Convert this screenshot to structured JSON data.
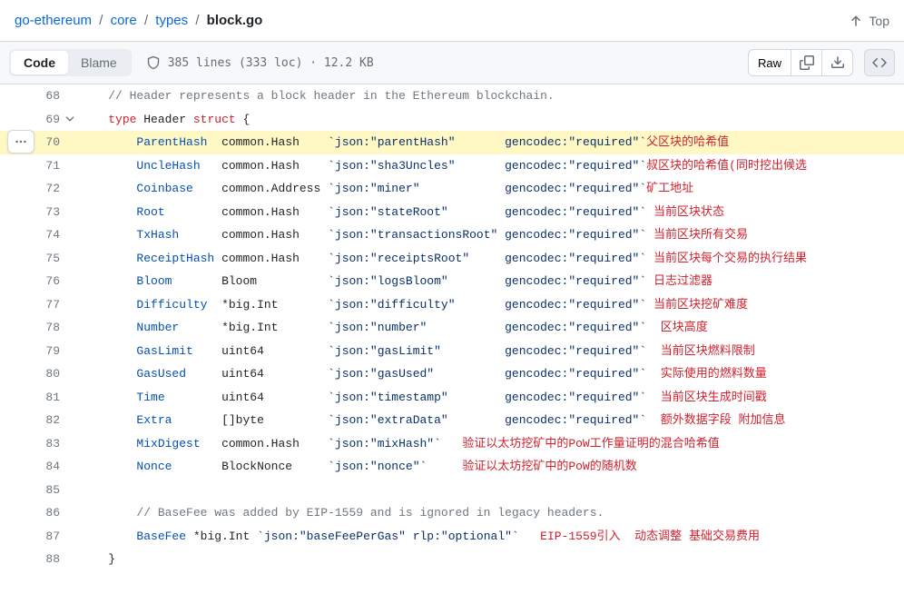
{
  "breadcrumb": {
    "parts": [
      "go-ethereum",
      "core",
      "types"
    ],
    "current": "block.go"
  },
  "top_link": "Top",
  "tabs": {
    "code": "Code",
    "blame": "Blame"
  },
  "file_info": "385 lines (333 loc) · 12.2 KB",
  "raw_label": "Raw",
  "code": {
    "lines": [
      {
        "n": 68,
        "comment": "// Header represents a block header in the Ethereum blockchain."
      },
      {
        "n": 69,
        "decl": {
          "k1": "type",
          "name": "Header",
          "k2": "struct",
          "brace": " {"
        },
        "chev": true
      },
      {
        "n": 70,
        "hl": true,
        "field": "ParentHash",
        "type": "common.Hash",
        "tag": "`json:\"parentHash\"       gencodec:\"required\"`",
        "anno": "父区块的哈希值"
      },
      {
        "n": 71,
        "field": "UncleHash",
        "type": "common.Hash",
        "tag": "`json:\"sha3Uncles\"       gencodec:\"required\"`",
        "anno": "叔区块的哈希值(同时挖出候选"
      },
      {
        "n": 72,
        "field": "Coinbase",
        "type": "common.Address",
        "tag": "`json:\"miner\"            gencodec:\"required\"`",
        "anno": "矿工地址"
      },
      {
        "n": 73,
        "field": "Root",
        "type": "common.Hash",
        "tag": "`json:\"stateRoot\"        gencodec:\"required\"`",
        "anno": " 当前区块状态"
      },
      {
        "n": 74,
        "field": "TxHash",
        "type": "common.Hash",
        "tag": "`json:\"transactionsRoot\" gencodec:\"required\"`",
        "anno": " 当前区块所有交易"
      },
      {
        "n": 75,
        "field": "ReceiptHash",
        "type": "common.Hash",
        "tag": "`json:\"receiptsRoot\"     gencodec:\"required\"`",
        "anno": " 当前区块每个交易的执行结果"
      },
      {
        "n": 76,
        "field": "Bloom",
        "type": "Bloom",
        "tag": "`json:\"logsBloom\"        gencodec:\"required\"`",
        "anno": " 日志过滤器"
      },
      {
        "n": 77,
        "field": "Difficulty",
        "type": "*big.Int",
        "tag": "`json:\"difficulty\"       gencodec:\"required\"`",
        "anno": " 当前区块挖矿难度"
      },
      {
        "n": 78,
        "field": "Number",
        "type": "*big.Int",
        "tag": "`json:\"number\"           gencodec:\"required\"`",
        "anno": "  区块高度"
      },
      {
        "n": 79,
        "field": "GasLimit",
        "type": "uint64",
        "tag": "`json:\"gasLimit\"         gencodec:\"required\"`",
        "anno": "  当前区块燃料限制"
      },
      {
        "n": 80,
        "field": "GasUsed",
        "type": "uint64",
        "tag": "`json:\"gasUsed\"          gencodec:\"required\"`",
        "anno": "  实际使用的燃料数量"
      },
      {
        "n": 81,
        "field": "Time",
        "type": "uint64",
        "tag": "`json:\"timestamp\"        gencodec:\"required\"`",
        "anno": "  当前区块生成时间戳"
      },
      {
        "n": 82,
        "field": "Extra",
        "type": "[]byte",
        "tag": "`json:\"extraData\"        gencodec:\"required\"`",
        "anno": "  额外数据字段 附加信息"
      },
      {
        "n": 83,
        "field": "MixDigest",
        "type": "common.Hash",
        "tag": "`json:\"mixHash\"`",
        "anno": "   验证以太坊挖矿中的PoW工作量证明的混合哈希值"
      },
      {
        "n": 84,
        "field": "Nonce",
        "type": "BlockNonce",
        "tag": "`json:\"nonce\"`",
        "anno": "     验证以太坊挖矿中的PoW的随机数"
      },
      {
        "n": 85,
        "blank": true
      },
      {
        "n": 86,
        "comment2": "// BaseFee was added by EIP-1559 and is ignored in legacy headers."
      },
      {
        "n": 87,
        "field2": "BaseFee",
        "type2": "*big.Int",
        "tag2": "`json:\"baseFeePerGas\" rlp:\"optional\"`",
        "anno2": "   EIP-1559引入  动态调整 基础交易费用"
      },
      {
        "n": 88,
        "close": "}"
      }
    ]
  }
}
